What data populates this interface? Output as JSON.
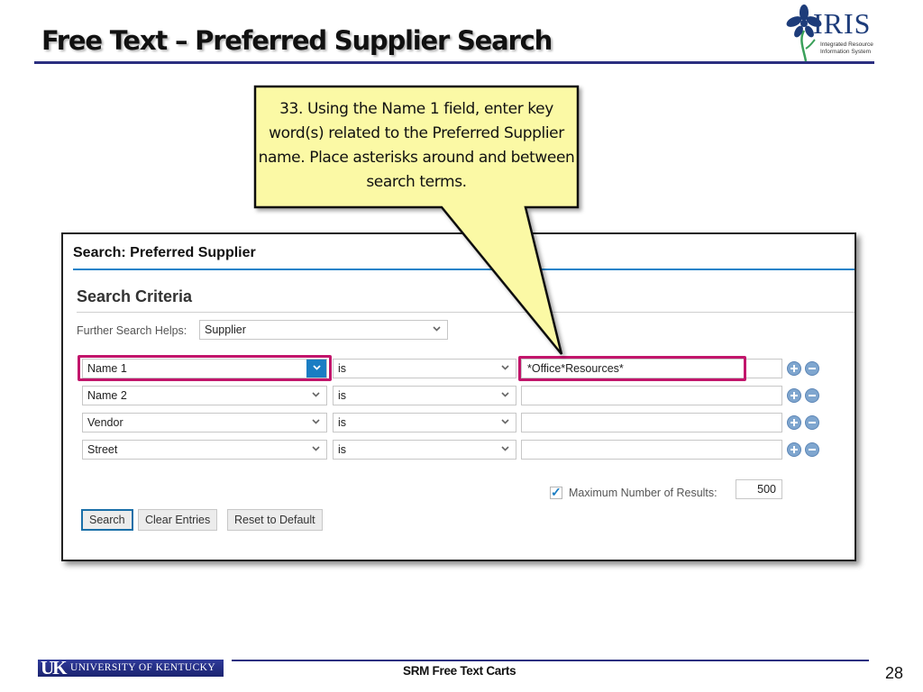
{
  "slide": {
    "title": "Free Text – Preferred Supplier Search",
    "callout_text": "33. Using the Name 1 field, enter key word(s) related to the Preferred Supplier name. Place asterisks around and between search terms.",
    "footer_text": "SRM Free Text Carts",
    "page_number": "28"
  },
  "logos": {
    "iris_word": "IRIS",
    "iris_subtitle_line1": "Integrated Resource",
    "iris_subtitle_line2": "Information System",
    "uk_mark": "UK",
    "uk_name": "UNIVERSITY OF KENTUCKY"
  },
  "colors": {
    "highlight": "#c2156b",
    "accent_blue": "#1a7dc3",
    "callout_fill": "#fbf9a5",
    "title_rule": "#2b2f80"
  },
  "search_panel": {
    "title": "Search: Preferred Supplier",
    "section_title": "Search Criteria",
    "further_helps_label": "Further Search Helps:",
    "further_helps_value": "Supplier",
    "criteria_rows": [
      {
        "field": "Name 1",
        "operator": "is",
        "value": "*Office*Resources*",
        "highlighted": true
      },
      {
        "field": "Name 2",
        "operator": "is",
        "value": "",
        "highlighted": false
      },
      {
        "field": "Vendor",
        "operator": "is",
        "value": "",
        "highlighted": false
      },
      {
        "field": "Street",
        "operator": "is",
        "value": "",
        "highlighted": false
      }
    ],
    "max_results_checked": true,
    "max_results_label": "Maximum Number of Results:",
    "max_results_value": "500",
    "buttons": {
      "search": "Search",
      "clear": "Clear Entries",
      "reset": "Reset to Default"
    }
  }
}
